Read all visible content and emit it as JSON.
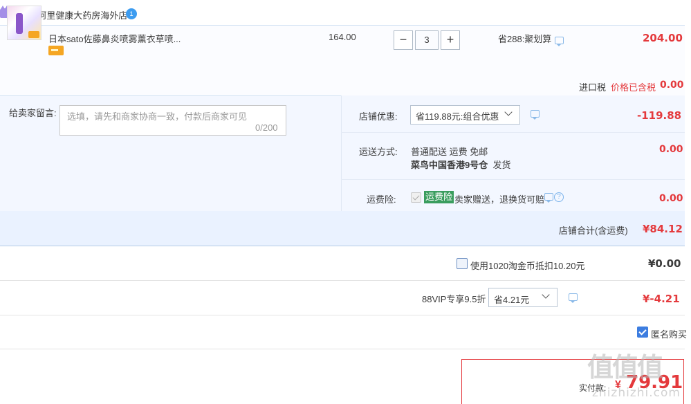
{
  "shop": {
    "label": "店铺: 阿里健康大药房海外店",
    "badge": "1"
  },
  "item": {
    "title": "日本sato佐藤鼻炎喷雾薰衣草喷...",
    "unit_price": "164.00",
    "quantity": "3",
    "qty_minus": "−",
    "qty_plus": "+",
    "promo": "省288:聚划算",
    "total": "204.00"
  },
  "tax": {
    "label": "进口税",
    "included": "价格已含税",
    "value": "0.00"
  },
  "message": {
    "label": "给卖家留言:",
    "placeholder": "选填，请先和商家协商一致，付款后商家可见",
    "count": "0/200"
  },
  "shop_coupon": {
    "label": "店铺优惠:",
    "selected": "省119.88元:组合优惠",
    "value": "-119.88"
  },
  "shipping": {
    "label": "运送方式:",
    "method": "普通配送 运费 免邮",
    "warehouse": "菜鸟中国香港9号仓",
    "ship_word": "发货",
    "value": "0.00"
  },
  "insurance": {
    "label": "运费险:",
    "badge": "运费险",
    "text": "卖家赠送，退换货可赔",
    "help": "?",
    "value": "0.00"
  },
  "shop_total": {
    "label": "店铺合计(含运费)",
    "value": "¥84.12"
  },
  "coins": {
    "label": "使用1020淘金币抵扣10.20元",
    "value": "¥0.00"
  },
  "vip": {
    "label": "88VIP专享9.5折",
    "selected": "省4.21元",
    "value": "¥-4.21"
  },
  "anonymous": {
    "label": "匿名购买"
  },
  "payment": {
    "label": "实付款:",
    "currency": "¥",
    "value": "79.91"
  },
  "watermark": {
    "main": "值值值",
    "sub": "zhizhizhi.com"
  },
  "colors": {
    "accent_red": "#e4393c",
    "light_blue_bg": "#f3f7ff",
    "total_row_bg": "#eaf2ff",
    "insurance_green": "#3a9d5e",
    "checkbox_blue": "#3c7de0"
  },
  "icons": [
    "shop-icon",
    "shop-level-badge",
    "product-thumbnail",
    "card-icon",
    "chat-icon",
    "help-icon",
    "chevron-down-icon",
    "checkbox-icon"
  ]
}
